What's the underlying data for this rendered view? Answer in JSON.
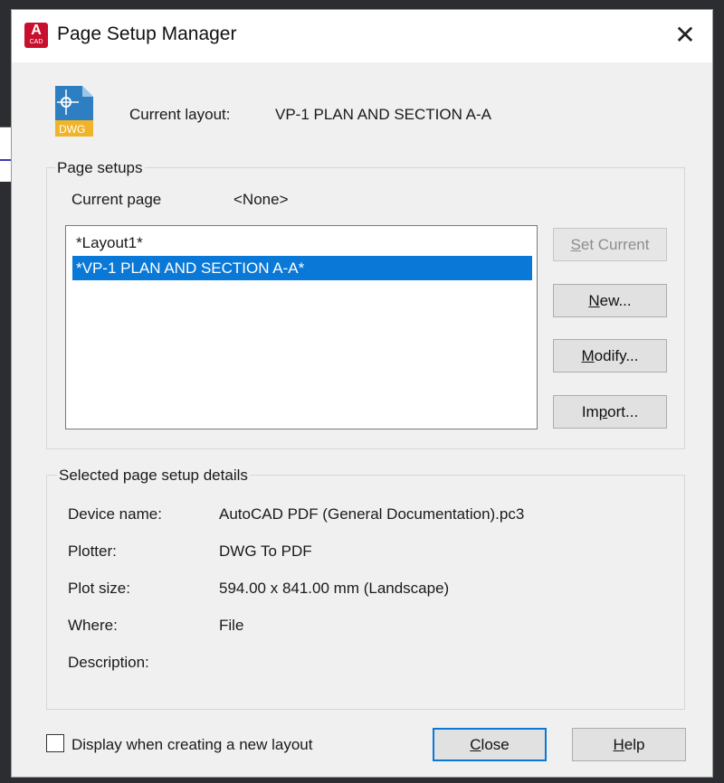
{
  "window": {
    "title": "Page Setup Manager",
    "app_icon_letter": "A",
    "app_icon_sub": "CAD",
    "close_glyph": "✕"
  },
  "file_icon": {
    "label": "DWG"
  },
  "current_layout": {
    "label": "Current layout:",
    "value": "VP-1 PLAN AND SECTION A-A"
  },
  "page_setups": {
    "legend": "Page setups",
    "current_page_label": "Current page",
    "current_page_value": "<None>",
    "items": [
      {
        "label": "*Layout1*",
        "selected": false
      },
      {
        "label": "*VP-1 PLAN AND SECTION A-A*",
        "selected": true
      }
    ]
  },
  "buttons": {
    "set_current": {
      "accel": "S",
      "rest": "et Current"
    },
    "new": {
      "accel": "N",
      "rest": "ew..."
    },
    "modify": {
      "accel": "M",
      "rest": "odify..."
    },
    "import": {
      "pre": "Im",
      "accel": "p",
      "rest": "ort..."
    },
    "close": {
      "accel": "C",
      "rest": "lose"
    },
    "help": {
      "accel": "H",
      "rest": "elp"
    }
  },
  "details": {
    "legend": "Selected page setup details",
    "rows": [
      {
        "label": "Device name:",
        "value": "AutoCAD PDF (General Documentation).pc3"
      },
      {
        "label": "Plotter:",
        "value": "DWG To PDF"
      },
      {
        "label": "Plot size:",
        "value": "594.00 x 841.00 mm (Landscape)"
      },
      {
        "label": "Where:",
        "value": "File"
      },
      {
        "label": "Description:",
        "value": ""
      }
    ]
  },
  "checkbox": {
    "label": "Display when creating a new layout",
    "checked": false
  },
  "colors": {
    "selection": "#0a78d7",
    "brand": "#c8102e",
    "dwg_blue": "#2d7fc1",
    "dwg_yellow": "#f0b429"
  }
}
